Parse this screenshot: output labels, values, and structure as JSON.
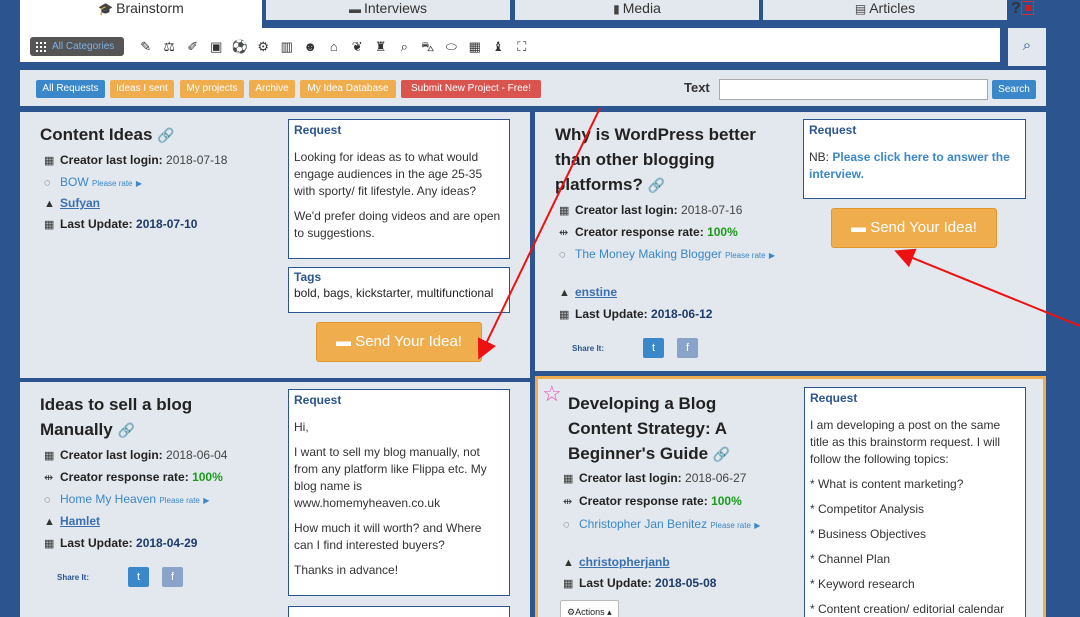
{
  "tabs": [
    {
      "label": "Brainstorm",
      "icon": "graduation-cap-icon"
    },
    {
      "label": "Interviews",
      "icon": "comment-icon"
    },
    {
      "label": "Media",
      "icon": "bar-chart-icon"
    },
    {
      "label": "Articles",
      "icon": "document-icon"
    }
  ],
  "help": "?",
  "categories": {
    "all_label": "All Categories",
    "icons": [
      "pencil-icon",
      "scales-icon",
      "eyedropper-icon",
      "tv-icon",
      "soccer-icon",
      "gears-icon",
      "book-icon",
      "people-icon",
      "home-icon",
      "leaf-icon",
      "hat-icon",
      "search-icon",
      "car-icon",
      "football-icon",
      "briefcase-icon",
      "mortarboard-icon",
      "expand-icon"
    ]
  },
  "filters": {
    "all_requests": "All Requests",
    "ideas_sent": "Ideas I sent",
    "my_projects": "My projects",
    "archive": "Archive",
    "idea_database": "My Idea Database",
    "submit_project": "Submit New Project - Free!",
    "text_label": "Text",
    "text_value": "",
    "search_button": "Search"
  },
  "labels": {
    "creator_login": "Creator last login:",
    "response_rate": "Creator response rate:",
    "last_update": "Last Update:",
    "please_rate": "Please rate",
    "request": "Request",
    "tags": "Tags",
    "send_idea": "Send Your Idea!",
    "share_it": "Share It:",
    "actions": "Actions"
  },
  "cards": [
    {
      "title": "Content Ideas",
      "login": "2018-07-18",
      "blog": "BOW",
      "user": "Sufyan",
      "update": "2018-07-10",
      "request": [
        "Looking for ideas as to what would engage audiences in the age 25-35 with sporty/ fit lifestyle. Any ideas?",
        "We'd prefer doing videos and are open to suggestions."
      ],
      "tags": "bold, bags, kickstarter, multifunctional"
    },
    {
      "title": "Why is WordPress better than other blogging platforms?",
      "login": "2018-07-16",
      "rate": "100%",
      "blog": "The Money Making Blogger",
      "user": "enstine",
      "update": "2018-06-12",
      "request_prefix": "NB:",
      "request_link": "Please click here to answer the interview."
    },
    {
      "title": "Ideas to sell a blog Manually",
      "login": "2018-06-04",
      "rate": "100%",
      "blog": "Home My Heaven",
      "user": "Hamlet",
      "update": "2018-04-29",
      "request": [
        "Hi,",
        "I want to sell my blog manually, not from any platform like Flippa etc. My blog name is www.homemyheaven.co.uk",
        "How much it will worth? and Where can I find interested buyers?",
        "Thanks in advance!"
      ]
    },
    {
      "title": "Developing a Blog Content Strategy: A Beginner's Guide",
      "login": "2018-06-27",
      "rate": "100%",
      "blog": "Christopher Jan Benitez",
      "user": "christopherjanb",
      "update": "2018-05-08",
      "request": [
        "I am developing a post on the same title as this brainstorm request. I will follow the following topics:",
        "* What is content marketing?",
        "* Competitor Analysis",
        "* Business Objectives",
        "* Channel Plan",
        "* Keyword research",
        "* Content creation/ editorial calendar"
      ]
    }
  ],
  "colors": {
    "primary": "#2c5590",
    "accent_orange": "#f0ad4e",
    "link_blue": "#3a87c9",
    "rate_green": "#1a9c1a",
    "annotation_red": "#ee1111"
  }
}
